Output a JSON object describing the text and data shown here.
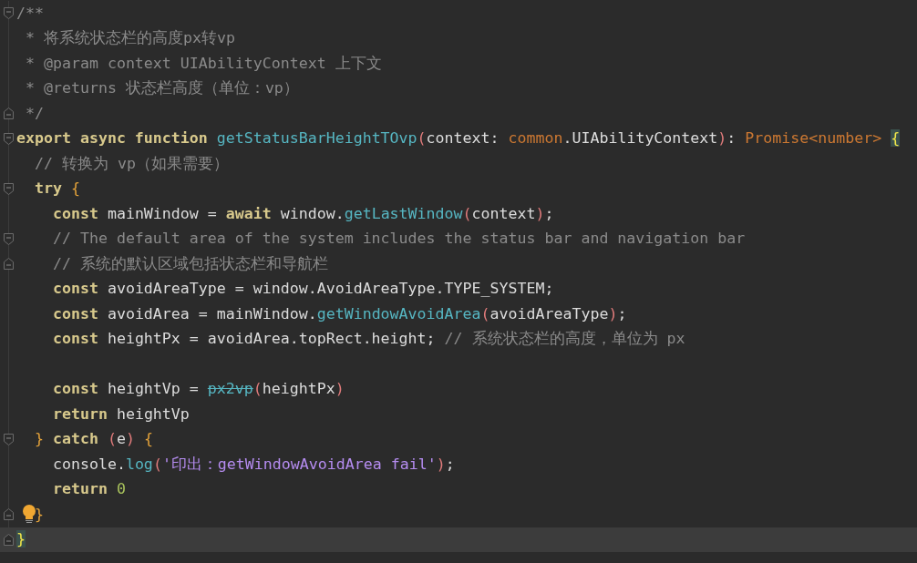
{
  "editor": {
    "lines": [
      {
        "fold_open": true,
        "current": false,
        "tokens": [
          {
            "kind": "comment",
            "text": "/**"
          }
        ]
      },
      {
        "current": false,
        "tokens": [
          {
            "kind": "comment",
            "text": " * 将系统状态栏的高度px转vp"
          }
        ]
      },
      {
        "current": false,
        "tokens": [
          {
            "kind": "comment",
            "text": " * @param context UIAbilityContext 上下文"
          }
        ]
      },
      {
        "current": false,
        "tokens": [
          {
            "kind": "comment",
            "text": " * @returns 状态栏高度（单位：vp）"
          }
        ]
      },
      {
        "fold_close": true,
        "current": false,
        "tokens": [
          {
            "kind": "comment",
            "text": " */"
          }
        ]
      },
      {
        "fold_open": true,
        "current": false,
        "tokens": [
          {
            "kind": "keyword",
            "text": "export async function "
          },
          {
            "kind": "function",
            "text": "getStatusBarHeightTOvp"
          },
          {
            "kind": "paren",
            "text": "("
          },
          {
            "kind": "plain",
            "text": "context: "
          },
          {
            "kind": "type",
            "text": "common"
          },
          {
            "kind": "plain",
            "text": ".UIAbilityContext"
          },
          {
            "kind": "paren",
            "text": ")"
          },
          {
            "kind": "plain",
            "text": ": "
          },
          {
            "kind": "type",
            "text": "Promise<number> "
          },
          {
            "kind": "brace",
            "text": "{",
            "matched": true
          }
        ]
      },
      {
        "current": false,
        "tokens": [
          {
            "kind": "comment",
            "text": "  // 转换为 vp（如果需要）"
          }
        ]
      },
      {
        "fold_open": true,
        "current": false,
        "tokens": [
          {
            "kind": "keyword",
            "text": "  try "
          },
          {
            "kind": "brace",
            "text": "{",
            "matched": false
          }
        ]
      },
      {
        "current": false,
        "tokens": [
          {
            "kind": "keyword",
            "text": "    const "
          },
          {
            "kind": "plain",
            "text": "mainWindow = "
          },
          {
            "kind": "keyword",
            "text": "await "
          },
          {
            "kind": "plain",
            "text": "window."
          },
          {
            "kind": "function",
            "text": "getLastWindow"
          },
          {
            "kind": "paren",
            "text": "("
          },
          {
            "kind": "plain",
            "text": "context"
          },
          {
            "kind": "paren",
            "text": ")"
          },
          {
            "kind": "plain",
            "text": ";"
          }
        ]
      },
      {
        "fold_open": true,
        "current": false,
        "tokens": [
          {
            "kind": "comment",
            "text": "    // The default area of the system includes the status bar and navigation bar"
          }
        ]
      },
      {
        "fold_close": true,
        "current": false,
        "tokens": [
          {
            "kind": "comment",
            "text": "    // 系统的默认区域包括状态栏和导航栏"
          }
        ]
      },
      {
        "current": false,
        "tokens": [
          {
            "kind": "keyword",
            "text": "    const "
          },
          {
            "kind": "plain",
            "text": "avoidAreaType = window.AvoidAreaType.TYPE_SYSTEM;"
          }
        ]
      },
      {
        "current": false,
        "tokens": [
          {
            "kind": "keyword",
            "text": "    const "
          },
          {
            "kind": "plain",
            "text": "avoidArea = mainWindow."
          },
          {
            "kind": "function",
            "text": "getWindowAvoidArea"
          },
          {
            "kind": "paren",
            "text": "("
          },
          {
            "kind": "plain",
            "text": "avoidAreaType"
          },
          {
            "kind": "paren",
            "text": ")"
          },
          {
            "kind": "plain",
            "text": ";"
          }
        ]
      },
      {
        "current": false,
        "tokens": [
          {
            "kind": "keyword",
            "text": "    const "
          },
          {
            "kind": "plain",
            "text": "heightPx = avoidArea.topRect.height; "
          },
          {
            "kind": "comment",
            "text": "// 系统状态栏的高度，单位为 px"
          }
        ]
      },
      {
        "current": false
      },
      {
        "current": false,
        "tokens": [
          {
            "kind": "keyword",
            "text": "    const "
          },
          {
            "kind": "plain",
            "text": "heightVp = "
          },
          {
            "kind": "deprecated",
            "text": "px2vp"
          },
          {
            "kind": "paren",
            "text": "("
          },
          {
            "kind": "plain",
            "text": "heightPx"
          },
          {
            "kind": "paren",
            "text": ")"
          }
        ]
      },
      {
        "current": false,
        "tokens": [
          {
            "kind": "keyword",
            "text": "    return "
          },
          {
            "kind": "plain",
            "text": "heightVp"
          }
        ]
      },
      {
        "fold_open": true,
        "current": false,
        "tokens": [
          {
            "kind": "brace",
            "text": "  }",
            "matched": false
          },
          {
            "kind": "keyword",
            "text": " catch "
          },
          {
            "kind": "paren",
            "text": "("
          },
          {
            "kind": "plain",
            "text": "e"
          },
          {
            "kind": "paren",
            "text": ")"
          },
          {
            "kind": "brace",
            "text": " {",
            "matched": false
          }
        ]
      },
      {
        "current": false,
        "tokens": [
          {
            "kind": "plain",
            "text": "    console."
          },
          {
            "kind": "function",
            "text": "log"
          },
          {
            "kind": "paren",
            "text": "("
          },
          {
            "kind": "string",
            "text": "'印出：getWindowAvoidArea fail'"
          },
          {
            "kind": "paren",
            "text": ")"
          },
          {
            "kind": "plain",
            "text": ";"
          }
        ]
      },
      {
        "current": false,
        "tokens": [
          {
            "kind": "keyword",
            "text": "    return "
          },
          {
            "kind": "number",
            "text": "0"
          }
        ]
      },
      {
        "fold_close": true,
        "hint": true,
        "current": false,
        "tokens": [
          {
            "kind": "brace",
            "text": "}",
            "matched": false
          }
        ]
      },
      {
        "fold_close": true,
        "current": true,
        "tokens": [
          {
            "kind": "brace",
            "text": "}",
            "matched": true
          }
        ]
      }
    ]
  }
}
